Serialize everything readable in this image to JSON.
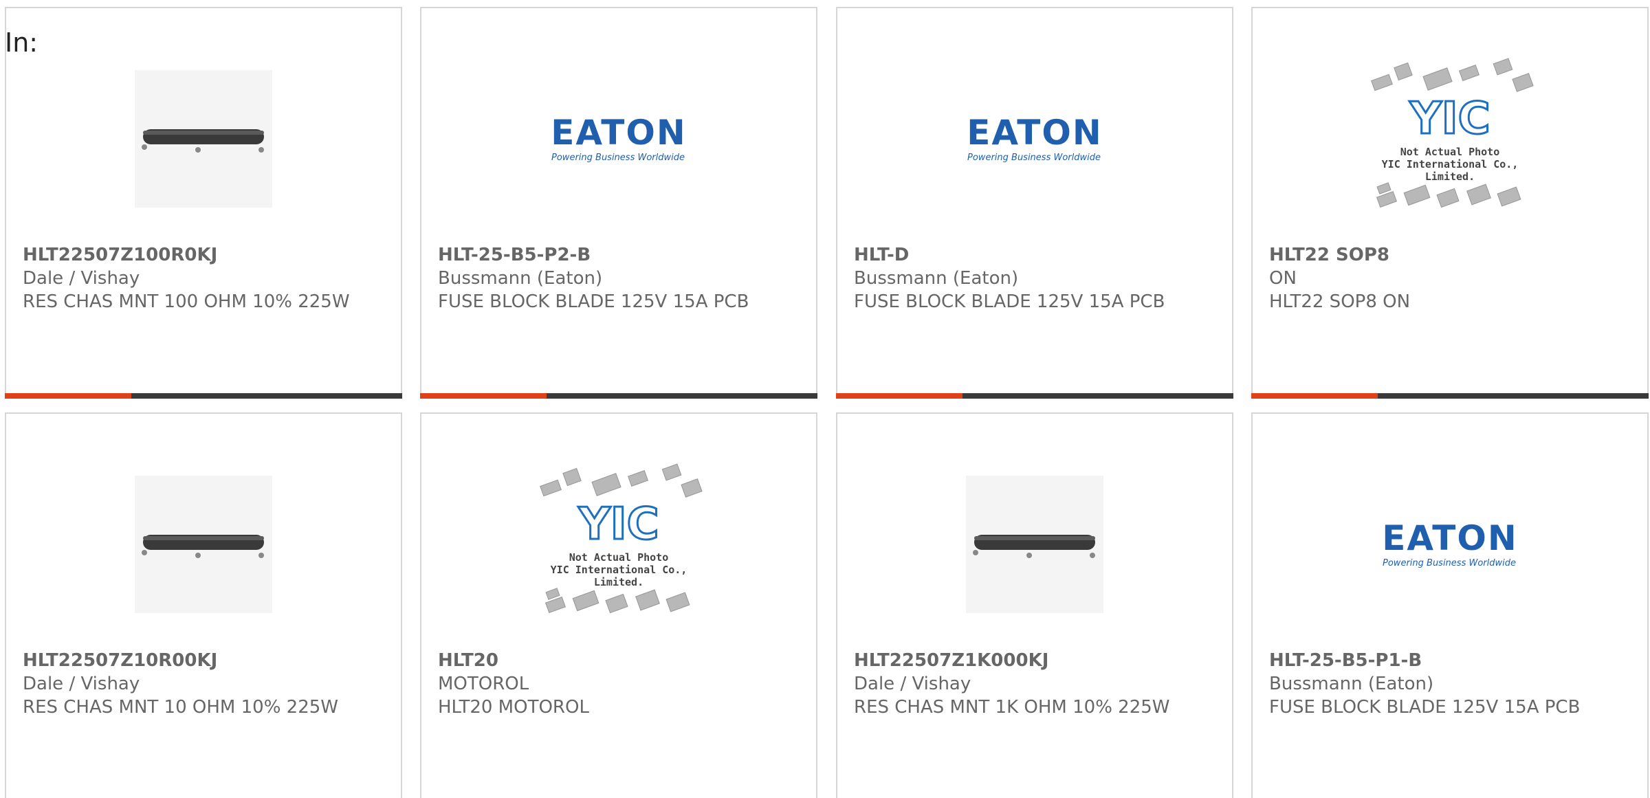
{
  "filter_label": "In:",
  "colors": {
    "card_border": "#d6d6d6",
    "accent": "#e0401a",
    "bar": "#3a3a3a",
    "text": "#666666",
    "eaton_blue": "#1f5fae"
  },
  "eaton_logo": {
    "name": "EATON",
    "tagline": "Powering Business Worldwide"
  },
  "yic_placeholder": {
    "logo": "YIC",
    "line1": "Not Actual Photo",
    "line2": "YIC International Co., Limited."
  },
  "products": [
    {
      "image": "resistor",
      "part_number": "HLT22507Z100R0KJ",
      "manufacturer": "Dale / Vishay",
      "description": "RES CHAS MNT 100 OHM 10% 225W"
    },
    {
      "image": "eaton",
      "part_number": "HLT-25-B5-P2-B",
      "manufacturer": "Bussmann (Eaton)",
      "description": "FUSE BLOCK BLADE 125V 15A PCB"
    },
    {
      "image": "eaton",
      "part_number": "HLT-D",
      "manufacturer": "Bussmann (Eaton)",
      "description": "FUSE BLOCK BLADE 125V 15A PCB"
    },
    {
      "image": "yic",
      "part_number": "HLT22 SOP8",
      "manufacturer": "ON",
      "description": "HLT22 SOP8 ON"
    },
    {
      "image": "resistor",
      "part_number": "HLT22507Z10R00KJ",
      "manufacturer": "Dale / Vishay",
      "description": "RES CHAS MNT 10 OHM 10% 225W"
    },
    {
      "image": "yic",
      "part_number": "HLT20",
      "manufacturer": "MOTOROL",
      "description": "HLT20 MOTOROL"
    },
    {
      "image": "resistor",
      "part_number": "HLT22507Z1K000KJ",
      "manufacturer": "Dale / Vishay",
      "description": "RES CHAS MNT 1K OHM 10% 225W"
    },
    {
      "image": "eaton",
      "part_number": "HLT-25-B5-P1-B",
      "manufacturer": "Bussmann (Eaton)",
      "description": "FUSE BLOCK BLADE 125V 15A PCB"
    }
  ]
}
